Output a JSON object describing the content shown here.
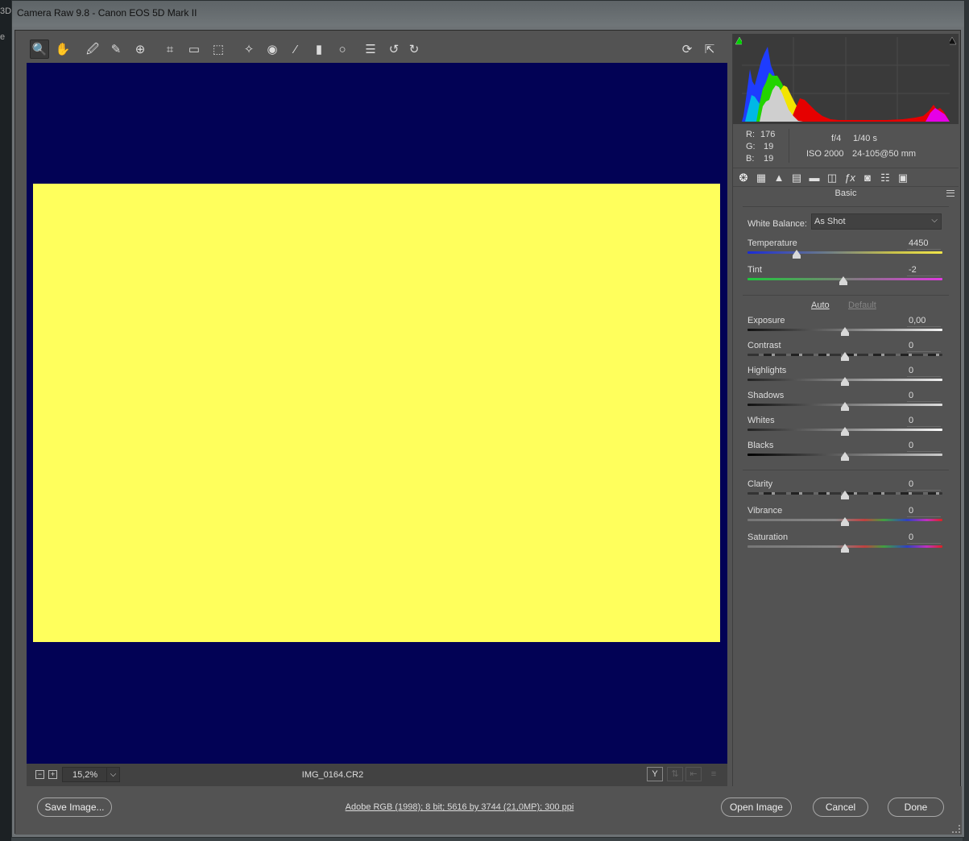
{
  "window": {
    "title": "Camera Raw 9.8  -  Canon EOS 5D Mark II"
  },
  "desktop_edge": {
    "text_a": "3D",
    "text_b": "e"
  },
  "toolbar": {
    "tools": [
      {
        "name": "zoom-tool",
        "icon": "zoom-icon",
        "glyph": "🔍"
      },
      {
        "name": "hand-tool",
        "icon": "hand-icon",
        "glyph": "✋"
      },
      {
        "name": "white-balance-tool",
        "icon": "eyedropper-icon",
        "glyph": "🖉"
      },
      {
        "name": "color-sampler-tool",
        "icon": "color-sampler-icon",
        "glyph": "✎"
      },
      {
        "name": "targeted-adjustment-tool",
        "icon": "target-adjust-icon",
        "glyph": "⊕"
      },
      {
        "name": "crop-tool",
        "icon": "crop-icon",
        "glyph": "⌗"
      },
      {
        "name": "straighten-tool",
        "icon": "straighten-icon",
        "glyph": "▭"
      },
      {
        "name": "transform-tool",
        "icon": "transform-icon",
        "glyph": "⬚"
      },
      {
        "name": "spot-removal-tool",
        "icon": "spot-removal-icon",
        "glyph": "✧"
      },
      {
        "name": "red-eye-tool",
        "icon": "red-eye-icon",
        "glyph": "◉"
      },
      {
        "name": "adjustment-brush-tool",
        "icon": "brush-icon",
        "glyph": "⁄"
      },
      {
        "name": "graduated-filter-tool",
        "icon": "graduated-filter-icon",
        "glyph": "▮"
      },
      {
        "name": "radial-filter-tool",
        "icon": "radial-filter-icon",
        "glyph": "○"
      },
      {
        "name": "preferences-button",
        "icon": "list-icon",
        "glyph": "☰"
      },
      {
        "name": "rotate-ccw-button",
        "icon": "rotate-ccw-icon",
        "glyph": "↺"
      },
      {
        "name": "rotate-cw-button",
        "icon": "rotate-cw-icon",
        "glyph": "↻"
      }
    ],
    "right_tools": [
      {
        "name": "toggle-preview-button",
        "icon": "refresh-icon",
        "glyph": "⟳"
      },
      {
        "name": "fullscreen-button",
        "icon": "fullscreen-icon",
        "glyph": "⇱"
      }
    ]
  },
  "preview": {
    "background": "#020255",
    "photo_color": "#ffff5c"
  },
  "statusbar": {
    "zoom_out": "−",
    "zoom_in": "+",
    "zoom_value": "15,2%",
    "zoom_caret": "⌵",
    "filename": "IMG_0164.CR2",
    "view_button": "Y",
    "disabled_buttons": [
      "⇅",
      "⇤",
      "≡"
    ]
  },
  "histogram": {
    "shadow_clip_color": "#00d000",
    "highlight_clip_color": "#111111"
  },
  "readout": {
    "r_label": "R:",
    "r_value": "176",
    "g_label": "G:",
    "g_value": "19",
    "b_label": "B:",
    "b_value": "19",
    "aperture": "f/4",
    "shutter": "1/40 s",
    "iso": "ISO 2000",
    "lens": "24-105@50 mm"
  },
  "panel_tabs": [
    {
      "name": "basic-tab",
      "icon": "aperture-icon",
      "glyph": "❂"
    },
    {
      "name": "tone-curve-tab",
      "icon": "grid-icon",
      "glyph": "▦"
    },
    {
      "name": "detail-tab",
      "icon": "mountain-icon",
      "glyph": "▲"
    },
    {
      "name": "hsl-tab",
      "icon": "hsl-icon",
      "glyph": "▤"
    },
    {
      "name": "split-toning-tab",
      "icon": "split-toning-icon",
      "glyph": "▬"
    },
    {
      "name": "lens-corrections-tab",
      "icon": "lens-icon",
      "glyph": "◫"
    },
    {
      "name": "effects-tab",
      "icon": "fx-icon",
      "glyph": "ƒx"
    },
    {
      "name": "camera-calibration-tab",
      "icon": "camera-icon",
      "glyph": "◙"
    },
    {
      "name": "presets-tab",
      "icon": "presets-icon",
      "glyph": "☷"
    },
    {
      "name": "snapshots-tab",
      "icon": "snapshots-icon",
      "glyph": "▣"
    }
  ],
  "basic": {
    "title": "Basic",
    "white_balance_label": "White Balance:",
    "white_balance_value": "As Shot",
    "auto_label": "Auto",
    "default_label": "Default",
    "sliders": {
      "temperature": {
        "label": "Temperature",
        "value": "4450",
        "position": 0.25
      },
      "tint": {
        "label": "Tint",
        "value": "-2",
        "position": 0.49
      },
      "exposure": {
        "label": "Exposure",
        "value": "0,00",
        "position": 0.5
      },
      "contrast": {
        "label": "Contrast",
        "value": "0",
        "position": 0.5
      },
      "highlights": {
        "label": "Highlights",
        "value": "0",
        "position": 0.5
      },
      "shadows": {
        "label": "Shadows",
        "value": "0",
        "position": 0.5
      },
      "whites": {
        "label": "Whites",
        "value": "0",
        "position": 0.5
      },
      "blacks": {
        "label": "Blacks",
        "value": "0",
        "position": 0.5
      },
      "clarity": {
        "label": "Clarity",
        "value": "0",
        "position": 0.5
      },
      "vibrance": {
        "label": "Vibrance",
        "value": "0",
        "position": 0.5
      },
      "saturation": {
        "label": "Saturation",
        "value": "0",
        "position": 0.5
      }
    }
  },
  "footer": {
    "save_label": "Save Image...",
    "workflow_link": "Adobe RGB (1998); 8 bit; 5616 by 3744 (21,0MP); 300 ppi",
    "open_label": "Open Image",
    "cancel_label": "Cancel",
    "done_label": "Done"
  }
}
